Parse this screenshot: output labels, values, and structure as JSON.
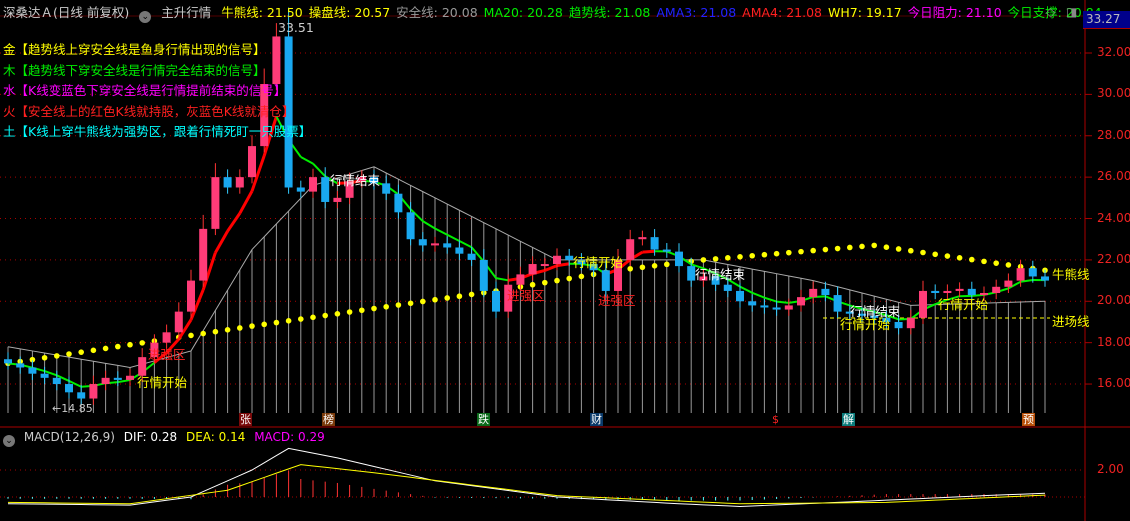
{
  "header": {
    "stock": "深桑达Ａ(日线 前复权)",
    "indicator": "主升行情",
    "values": [
      {
        "label": "牛熊线: 21.50",
        "color": "#ffff00"
      },
      {
        "label": "操盘线: 20.57",
        "color": "#ffff00"
      },
      {
        "label": "安全线: 20.08",
        "color": "#999999"
      },
      {
        "label": "MA20: 20.28",
        "color": "#00ee00"
      },
      {
        "label": "趋势线: 21.08",
        "color": "#00ee00"
      },
      {
        "label": "AMA3: 21.08",
        "color": "#2222ff"
      },
      {
        "label": "AMA4: 21.08",
        "color": "#ff2020"
      },
      {
        "label": "WH7: 19.17",
        "color": "#ffff00"
      },
      {
        "label": "今日阻力: 21.10",
        "color": "#ff00ff"
      },
      {
        "label": "今日支撑: 20.84",
        "color": "#00ee00"
      }
    ]
  },
  "legend": [
    {
      "text": "金【趋势线上穿安全线是鱼身行情出现的信号】",
      "color": "#ffff00"
    },
    {
      "text": "木【趋势线下穿安全线是行情完全结束的信号】",
      "color": "#00ee00"
    },
    {
      "text": "水【K线变蓝色下穿安全线是行情提前结束的信号】",
      "color": "#ff00ff"
    },
    {
      "text": "火【安全线上的红色K线就持股，灰蓝色K线就清仓】",
      "color": "#ff2020"
    },
    {
      "text": "土【K线上穿牛熊线为强势区，跟着行情死盯一只股票】",
      "color": "#00ffff"
    }
  ],
  "axis": {
    "current": "33.27",
    "ticks": [
      "32.00",
      "30.00",
      "28.00",
      "26.00",
      "24.00",
      "22.00",
      "20.00",
      "18.00",
      "16.00"
    ],
    "macd_tick": "2.00"
  },
  "annotations": {
    "high": "33.51",
    "low": "←14.85",
    "end": "行情结束",
    "start": "行情开始",
    "strong": "进强区",
    "bull_bear": "牛熊线",
    "entry": "进场线"
  },
  "markers": [
    "张",
    "榜",
    "跌",
    "财",
    "$",
    "解",
    "预"
  ],
  "macd": {
    "title": "MACD(12,26,9)",
    "dif": "DIF: 0.28",
    "dea": "DEA: 0.14",
    "macd": "MACD: 0.29"
  },
  "chart_data": {
    "type": "candlestick",
    "ylim": [
      14.5,
      33.6
    ],
    "close": [
      17.0,
      16.8,
      16.5,
      16.3,
      16.0,
      15.6,
      15.3,
      16.0,
      16.3,
      16.2,
      16.4,
      17.3,
      18.0,
      18.5,
      19.5,
      21.0,
      23.5,
      26.0,
      25.5,
      26.0,
      27.5,
      30.5,
      32.8,
      25.5,
      25.3,
      26.0,
      24.8,
      25.0,
      25.8,
      26.0,
      25.7,
      25.2,
      24.3,
      23.0,
      22.7,
      22.8,
      22.6,
      22.3,
      22.0,
      20.5,
      19.5,
      20.8,
      21.3,
      21.8,
      21.8,
      22.2,
      22.0,
      21.8,
      21.5,
      20.5,
      22.0,
      23.0,
      23.1,
      22.5,
      22.4,
      21.7,
      21.0,
      21.2,
      20.8,
      20.5,
      20.0,
      19.8,
      19.7,
      19.6,
      19.8,
      20.2,
      20.6,
      20.3,
      19.5,
      19.4,
      19.3,
      19.2,
      19.0,
      18.7,
      19.2,
      20.5,
      20.4,
      20.5,
      20.6,
      20.3,
      20.4,
      20.7,
      21.0,
      21.6,
      21.2,
      21.0
    ],
    "bull_bear_line": [
      [
        0,
        17.0
      ],
      [
        20,
        18.8
      ],
      [
        40,
        20.5
      ],
      [
        50,
        21.5
      ],
      [
        57,
        22.0
      ],
      [
        71,
        22.7
      ],
      [
        85,
        21.5
      ]
    ],
    "safety_line": [
      [
        0,
        17.8
      ],
      [
        10,
        16.8
      ],
      [
        15,
        17.6
      ],
      [
        20,
        22.5
      ],
      [
        25,
        25.6
      ],
      [
        30,
        26.5
      ],
      [
        45,
        22.0
      ],
      [
        57,
        22.0
      ],
      [
        66,
        21.0
      ],
      [
        74,
        19.8
      ],
      [
        85,
        20.0
      ]
    ],
    "macd_dif": [
      [
        0,
        -0.5
      ],
      [
        10,
        -0.6
      ],
      [
        15,
        0
      ],
      [
        20,
        2.0
      ],
      [
        23,
        3.6
      ],
      [
        27,
        2.9
      ],
      [
        35,
        1.2
      ],
      [
        45,
        0
      ],
      [
        55,
        -0.5
      ],
      [
        60,
        -0.7
      ],
      [
        68,
        -0.4
      ],
      [
        80,
        0.1
      ],
      [
        85,
        0.28
      ]
    ],
    "macd_dea": [
      [
        0,
        -0.4
      ],
      [
        10,
        -0.5
      ],
      [
        18,
        0.5
      ],
      [
        24,
        2.4
      ],
      [
        30,
        1.8
      ],
      [
        45,
        0.1
      ],
      [
        60,
        -0.5
      ],
      [
        72,
        -0.4
      ],
      [
        85,
        0.14
      ]
    ]
  }
}
